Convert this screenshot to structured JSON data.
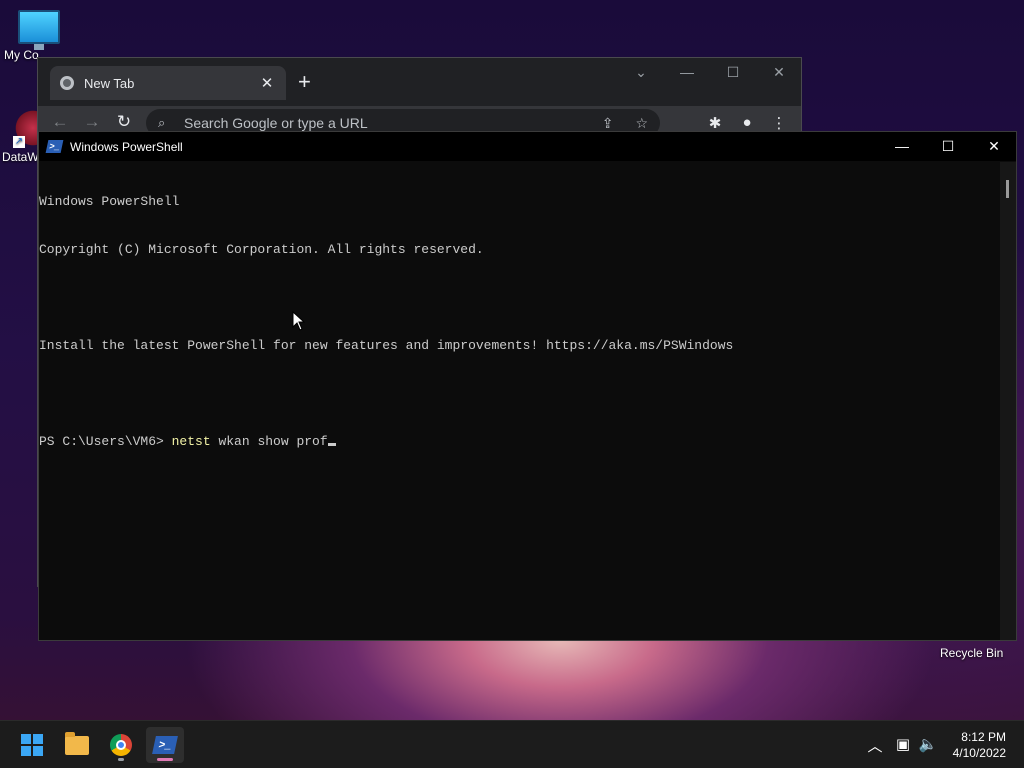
{
  "desktop": {
    "icons": [
      {
        "label": "My Co"
      },
      {
        "label": "DataW"
      }
    ],
    "recycle_bin_label": "Recycle Bin"
  },
  "chrome": {
    "tab_title": "New Tab",
    "tab_close_glyph": "✕",
    "new_tab_glyph": "+",
    "omnibox_placeholder": "Search Google or type a URL",
    "glyphs": {
      "back": "←",
      "forward": "→",
      "reload": "↻",
      "search": "⌕",
      "share": "⇪",
      "star": "☆",
      "extensions": "✱",
      "profile": "●",
      "menu": "⋮",
      "tab_search": "⌄",
      "minimize": "—",
      "maximize": "☐",
      "close": "✕"
    }
  },
  "powershell": {
    "title": "Windows PowerShell",
    "logo_glyph": ">_",
    "controls": {
      "minimize": "—",
      "maximize": "☐",
      "close": "✕"
    },
    "lines": [
      "Windows PowerShell",
      "Copyright (C) Microsoft Corporation. All rights reserved.",
      "",
      "Install the latest PowerShell for new features and improvements! https://aka.ms/PSWindows",
      ""
    ],
    "prompt": "PS C:\\Users\\VM6> ",
    "command_verb": "netst",
    "command_args": " wkan show prof"
  },
  "taskbar": {
    "clock_time": "8:12 PM",
    "clock_date": "4/10/2022",
    "tray_glyphs": {
      "chevron": "︿",
      "network": "▣",
      "volume": "🔈"
    },
    "ps_logo_glyph": ">_",
    "indicator_colors": {
      "chrome": "#9aa0a6",
      "powershell": "#e07ab5"
    }
  },
  "colors": {
    "console_bg": "#0c0c0c",
    "console_text": "#cccccc",
    "command_highlight": "#f2f2a6",
    "windows_accent": "#3ba7f5"
  }
}
